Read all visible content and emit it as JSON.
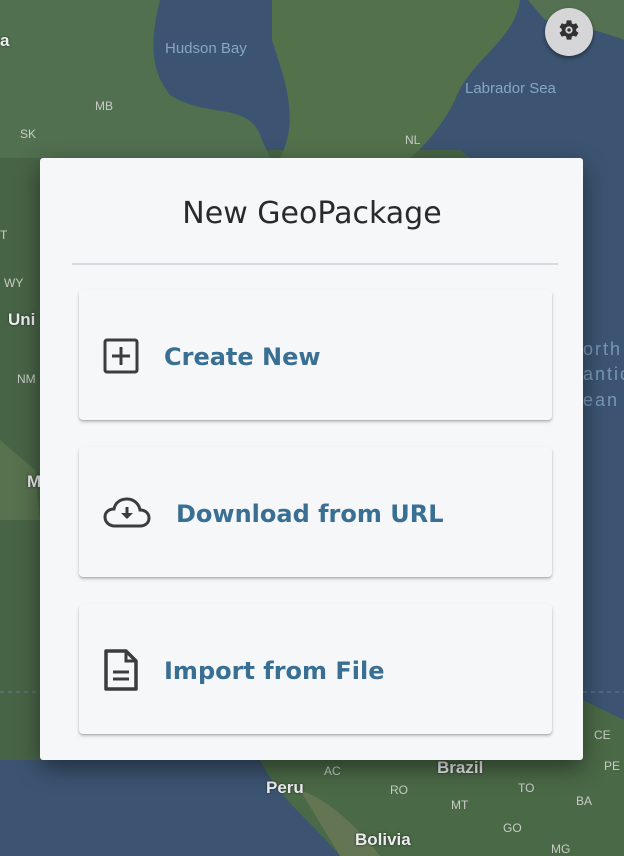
{
  "map": {
    "labels": {
      "hudson_bay": "Hudson Bay",
      "labrador_sea": "Labrador Sea",
      "mb": "MB",
      "sk": "SK",
      "nl": "NL",
      "wy": "WY",
      "uni": "Uni",
      "nm": "NM",
      "m": "M",
      "t": "T",
      "a": "a",
      "north_partial": "orth",
      "atlantic_partial": "antic",
      "ocean_partial": "ean",
      "peru": "Peru",
      "brazil": "Brazil",
      "bolivia": "Bolivia",
      "ac": "AC",
      "ro": "RO",
      "mt": "MT",
      "to": "TO",
      "ba": "BA",
      "go": "GO",
      "mg": "MG",
      "ce": "CE",
      "pe": "PE"
    },
    "colors": {
      "water": "#3f5a78",
      "land": "#4f6e4a"
    }
  },
  "settings": {
    "icon": "gear-icon"
  },
  "dialog": {
    "title": "New GeoPackage",
    "options": [
      {
        "label": "Create New",
        "icon": "add-box-icon"
      },
      {
        "label": "Download from URL",
        "icon": "cloud-download-icon"
      },
      {
        "label": "Import from File",
        "icon": "document-icon"
      }
    ],
    "accent_color": "#3a6f94"
  }
}
